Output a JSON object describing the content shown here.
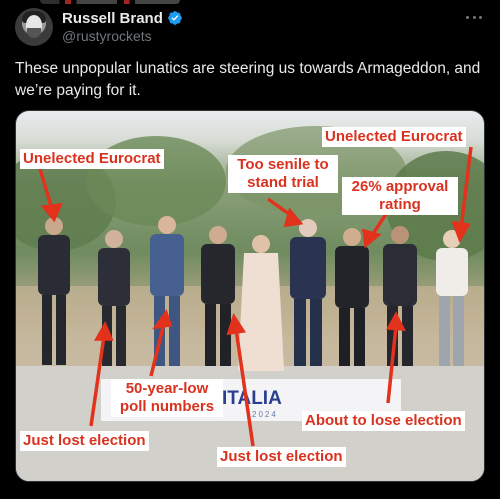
{
  "header": {
    "display_name": "Russell Brand",
    "handle": "@rustyrockets",
    "verified_icon": "verified-badge-icon",
    "more_icon": "more-options-icon"
  },
  "tweet": {
    "text": "These unpopular lunatics are steering us towards Armageddon, and we’re paying for it."
  },
  "media": {
    "banner_text": "ITALIA",
    "banner_year": "2024",
    "labels": {
      "left_eurocrat": "Unelected Eurocrat",
      "right_eurocrat": "Unelected Eurocrat",
      "too_senile": "Too senile to stand trial",
      "approval": "26% approval rating",
      "poll": "50-year-low poll numbers",
      "lost_left": "Just lost election",
      "lost_center": "Just lost election",
      "lose_election": "About to lose election"
    }
  },
  "colors": {
    "background": "#000000",
    "text_primary": "#e7e9ea",
    "text_secondary": "#71767b",
    "verified_blue": "#1d9bf0",
    "annotation_red": "#d9321f"
  }
}
